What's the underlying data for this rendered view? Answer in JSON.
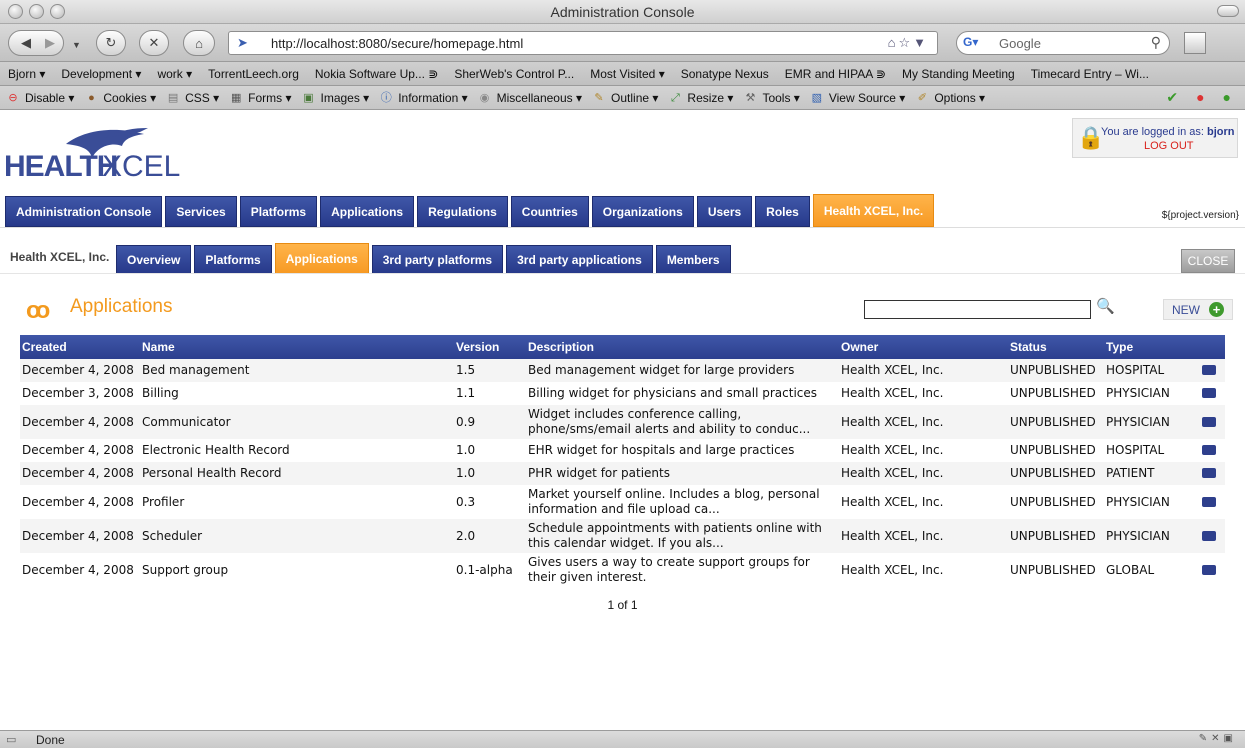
{
  "window": {
    "title": "Administration Console"
  },
  "nav": {
    "url": "http://localhost:8080/secure/homepage.html",
    "search_placeholder": "Google"
  },
  "bookmarks": [
    "Bjorn ▾",
    "Development ▾",
    "work ▾",
    "TorrentLeech.org",
    "Nokia Software Up... ⋑",
    "SherWeb's Control P...",
    "Most Visited ▾",
    "Sonatype Nexus",
    "EMR and HIPAA ⋑",
    "My Standing Meeting",
    "Timecard Entry – Wi..."
  ],
  "devtools": [
    "Disable ▾",
    "Cookies ▾",
    "CSS ▾",
    "Forms ▾",
    "Images ▾",
    "Information ▾",
    "Miscellaneous ▾",
    "Outline ▾",
    "Resize ▾",
    "Tools ▾",
    "View Source ▾",
    "Options ▾"
  ],
  "login": {
    "prefix": "You are logged in as:",
    "user": "bjorn",
    "logout": "LOG OUT"
  },
  "logo": {
    "part1": "HEALTH",
    "part2": "XCEL"
  },
  "main_tabs": [
    {
      "label": "Administration Console",
      "active": false
    },
    {
      "label": "Services",
      "active": false
    },
    {
      "label": "Platforms",
      "active": false
    },
    {
      "label": "Applications",
      "active": false
    },
    {
      "label": "Regulations",
      "active": false
    },
    {
      "label": "Countries",
      "active": false
    },
    {
      "label": "Organizations",
      "active": false
    },
    {
      "label": "Users",
      "active": false
    },
    {
      "label": "Roles",
      "active": false
    },
    {
      "label": "Health XCEL, Inc.",
      "active": true
    }
  ],
  "version": "${project.version}",
  "company": "Health XCEL, Inc.",
  "sub_tabs": [
    {
      "label": "Overview",
      "active": false
    },
    {
      "label": "Platforms",
      "active": false
    },
    {
      "label": "Applications",
      "active": true
    },
    {
      "label": "3rd party platforms",
      "active": false
    },
    {
      "label": "3rd party applications",
      "active": false
    },
    {
      "label": "Members",
      "active": false
    }
  ],
  "close_label": "CLOSE",
  "section_title": "Applications",
  "new_label": "NEW",
  "table": {
    "headers": [
      "Created",
      "Name",
      "Version",
      "Description",
      "Owner",
      "Status",
      "Type"
    ],
    "rows": [
      {
        "created": "December 4, 2008",
        "name": "Bed management",
        "version": "1.5",
        "description": "Bed management widget for large providers",
        "owner": "Health XCEL, Inc.",
        "status": "UNPUBLISHED",
        "type": "HOSPITAL"
      },
      {
        "created": "December 3, 2008",
        "name": "Billing",
        "version": "1.1",
        "description": "Billing widget for physicians and small practices",
        "owner": "Health XCEL, Inc.",
        "status": "UNPUBLISHED",
        "type": "PHYSICIAN"
      },
      {
        "created": "December 4, 2008",
        "name": "Communicator",
        "version": "0.9",
        "description": "Widget includes conference calling, phone/sms/email alerts and ability to conduc...",
        "owner": "Health XCEL, Inc.",
        "status": "UNPUBLISHED",
        "type": "PHYSICIAN"
      },
      {
        "created": "December 4, 2008",
        "name": "Electronic Health Record",
        "version": "1.0",
        "description": "EHR widget for hospitals and large practices",
        "owner": "Health XCEL, Inc.",
        "status": "UNPUBLISHED",
        "type": "HOSPITAL"
      },
      {
        "created": "December 4, 2008",
        "name": "Personal Health Record",
        "version": "1.0",
        "description": "PHR widget for patients",
        "owner": "Health XCEL, Inc.",
        "status": "UNPUBLISHED",
        "type": "PATIENT"
      },
      {
        "created": "December 4, 2008",
        "name": "Profiler",
        "version": "0.3",
        "description": "Market yourself online. Includes a blog, personal information and file upload ca...",
        "owner": "Health XCEL, Inc.",
        "status": "UNPUBLISHED",
        "type": "PHYSICIAN"
      },
      {
        "created": "December 4, 2008",
        "name": "Scheduler",
        "version": "2.0",
        "description": "Schedule appointments with patients online with this calendar widget. If you als...",
        "owner": "Health XCEL, Inc.",
        "status": "UNPUBLISHED",
        "type": "PHYSICIAN"
      },
      {
        "created": "December 4, 2008",
        "name": "Support group",
        "version": "0.1-alpha",
        "description": "Gives users a way to create support groups for their given interest.",
        "owner": "Health XCEL, Inc.",
        "status": "UNPUBLISHED",
        "type": "GLOBAL"
      }
    ]
  },
  "pager": "1 of 1",
  "status": "Done",
  "colors": {
    "brand_blue": "#2c3f8e",
    "accent_orange": "#f79a24",
    "logout_red": "#d9221c"
  }
}
